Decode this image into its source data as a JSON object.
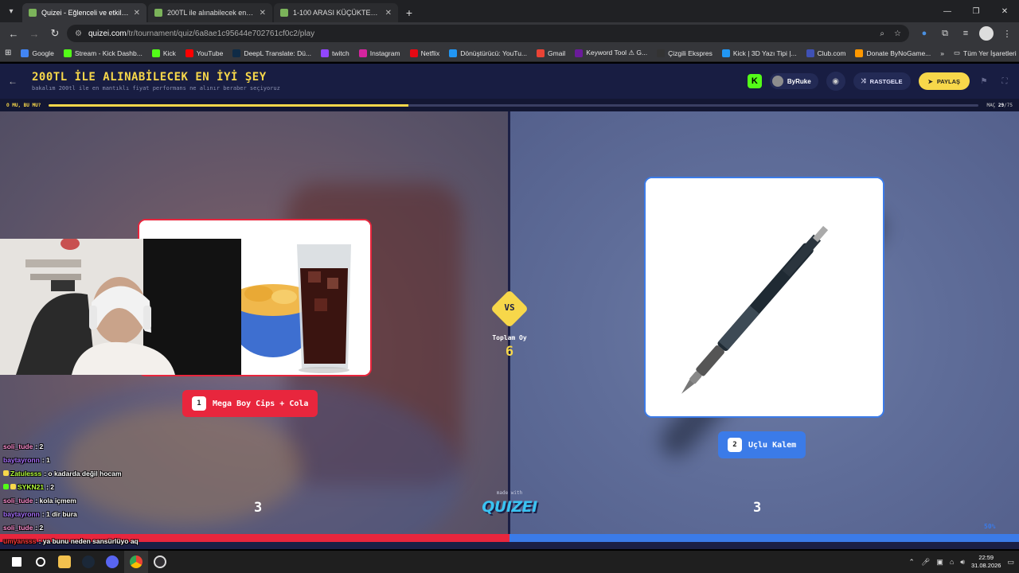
{
  "browser": {
    "tabs": [
      {
        "title": "Quizei - Eğlenceli ve etkileşimli",
        "active": true
      },
      {
        "title": "200TL ile alınabilecek en iyi şey",
        "active": false
      },
      {
        "title": "1-100 ARASI KÜÇÜKTEN BÜYÜĞE",
        "active": false
      }
    ],
    "url_host": "quizei.com",
    "url_path": "/tr/tournament/quiz/6a8ae1c95644e702761cf0c2/play",
    "bookmarks": [
      {
        "label": "Google",
        "color": "#4285f4"
      },
      {
        "label": "Stream - Kick Dashb...",
        "color": "#53fc18"
      },
      {
        "label": "Kick",
        "color": "#53fc18"
      },
      {
        "label": "YouTube",
        "color": "#ff0000"
      },
      {
        "label": "DeepL Translate: Dü...",
        "color": "#0f2b46"
      },
      {
        "label": "twitch",
        "color": "#9146ff"
      },
      {
        "label": "Instagram",
        "color": "#d6249f"
      },
      {
        "label": "Netflix",
        "color": "#e50914"
      },
      {
        "label": "Dönüştürücü: YouTu...",
        "color": "#2196f3"
      },
      {
        "label": "Gmail",
        "color": "#ea4335"
      },
      {
        "label": "Keyword Tool ⚠ G...",
        "color": "#6a1b9a"
      },
      {
        "label": "Çizgili Ekspres",
        "color": "#333333"
      },
      {
        "label": "Kick | 3D Yazı Tipi |...",
        "color": "#2196f3"
      },
      {
        "label": "Club.com",
        "color": "#3f51b5"
      },
      {
        "label": "Donate ByNoGame...",
        "color": "#ff9800"
      }
    ],
    "all_bookmarks": "Tüm Yer İşaretleri"
  },
  "quiz": {
    "title": "200TL İLE ALINABİLECEK EN İYİ ŞEY",
    "subtitle": "bakalım 200tl ile en mantıklı fiyat performans ne alınır beraber seçiyoruz",
    "user": "ByRuke",
    "random_label": "RASTGELE",
    "share_label": "PAYLAŞ",
    "round_label": "O MU, BU MU?",
    "match_prefix": "MAÇ",
    "match_current": "29",
    "match_total": "/75",
    "progress": 0.3867,
    "left": {
      "num": "1",
      "label": "Mega Boy Cips + Cola",
      "score": "3"
    },
    "right": {
      "num": "2",
      "label": "Uçlu Kalem",
      "score": "3"
    },
    "vs": "VS",
    "total_label": "Toplam Oy",
    "total_value": "6",
    "made_with": "made with",
    "logo": "QUIZEI",
    "right_percent": "50%",
    "colors": {
      "left": "#e8263d",
      "right": "#3b7be8",
      "accent": "#f7d74a",
      "header": "#181d42"
    }
  },
  "chat": [
    {
      "user": "soli_tude",
      "text": ": 2",
      "color": "#ff8fd1"
    },
    {
      "user": "baytayronn",
      "text": ": 1",
      "color": "#a970ff"
    },
    {
      "user": "Zatulesss",
      "text": ": o kadarda değil hocam",
      "color": "#b5ff3a",
      "badge": "#f7d74a"
    },
    {
      "user": "SYKN21",
      "text": ": 2",
      "color": "#b5ff3a",
      "badge": "#53fc18"
    },
    {
      "user": "soli_tude",
      "text": ": kola içmem",
      "color": "#ff8fd1"
    },
    {
      "user": "baytayronn",
      "text": ": 1 dir bura",
      "color": "#a970ff"
    },
    {
      "user": "soli_tude",
      "text": ": 2",
      "color": "#ff8fd1"
    },
    {
      "user": "umyansss",
      "text": ": ya bunu neden sansürlüyo aq",
      "color": "#ff3a3a"
    }
  ],
  "taskbar": {
    "time": "22:59",
    "date": "31.08.2026"
  }
}
